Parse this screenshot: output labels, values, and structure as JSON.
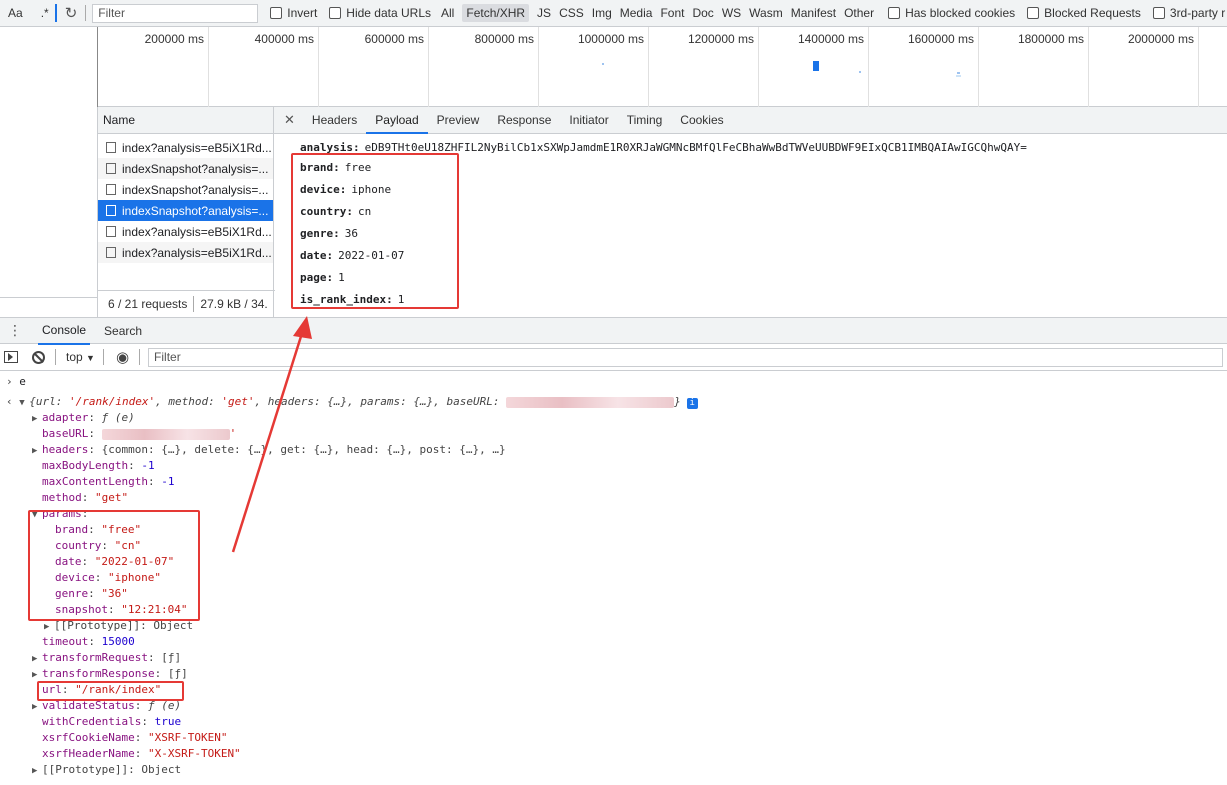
{
  "filterbar": {
    "aa_label": "Aa",
    "regex_label": ".*",
    "filter_placeholder": "Filter",
    "invert_label": "Invert",
    "hide_data_urls_label": "Hide data URLs",
    "types": [
      "All",
      "Fetch/XHR",
      "JS",
      "CSS",
      "Img",
      "Media",
      "Font",
      "Doc",
      "WS",
      "Wasm",
      "Manifest",
      "Other"
    ],
    "selected_type": "Fetch/XHR",
    "has_blocked_cookies_label": "Has blocked cookies",
    "blocked_requests_label": "Blocked Requests",
    "third_party_label": "3rd-party r"
  },
  "overview": {
    "ticks": [
      "200000 ms",
      "400000 ms",
      "600000 ms",
      "800000 ms",
      "1000000 ms",
      "1200000 ms",
      "1400000 ms",
      "1600000 ms",
      "1800000 ms",
      "2000000 ms"
    ]
  },
  "requests": {
    "header": "Name",
    "rows": [
      "index?analysis=eB5iX1Rd...",
      "indexSnapshot?analysis=...",
      "indexSnapshot?analysis=...",
      "indexSnapshot?analysis=...",
      "index?analysis=eB5iX1Rd...",
      "index?analysis=eB5iX1Rd..."
    ],
    "selected_index": 3,
    "footer_count": "6 / 21 requests",
    "footer_size": "27.9 kB / 34."
  },
  "detail": {
    "tabs": [
      "Headers",
      "Payload",
      "Preview",
      "Response",
      "Initiator",
      "Timing",
      "Cookies"
    ],
    "selected_tab": "Payload",
    "payload": [
      {
        "key": "analysis:",
        "value": "eDB9THt0eU18ZHFIL2NyBilCb1xSXWpJamdmE1R0XRJaWGMNcBMfQlFeCBhaWwBdTWVeUUBDWF9EIxQCB1IMBQAIAwIGCQhwQAY="
      },
      {
        "key": "brand:",
        "value": "free"
      },
      {
        "key": "device:",
        "value": "iphone"
      },
      {
        "key": "country:",
        "value": "cn"
      },
      {
        "key": "genre:",
        "value": "36"
      },
      {
        "key": "date:",
        "value": "2022-01-07"
      },
      {
        "key": "page:",
        "value": "1"
      },
      {
        "key": "is_rank_index:",
        "value": "1"
      }
    ]
  },
  "drawer": {
    "tabs": [
      "Console",
      "Search"
    ],
    "selected_tab": "Console",
    "context": "top",
    "filter_placeholder": "Filter"
  },
  "console": {
    "input_line": "e",
    "summary": {
      "open": "{url: ",
      "url_val": "'/rank/index'",
      "method_key": ", method: ",
      "method_val": "'get'",
      "rest": ", headers: {…}, params: {…}, baseURL: ",
      "close": "}"
    },
    "props": [
      {
        "key": "adapter",
        "value": "ƒ (e)",
        "kind": "fn",
        "expandable": true
      },
      {
        "key": "baseURL",
        "value": "",
        "kind": "blurred",
        "expandable": false
      },
      {
        "key": "headers",
        "value": "{common: {…}, delete: {…}, get: {…}, head: {…}, post: {…}, …}",
        "kind": "obj",
        "expandable": true
      },
      {
        "key": "maxBodyLength",
        "value": "-1",
        "kind": "num",
        "expandable": false
      },
      {
        "key": "maxContentLength",
        "value": "-1",
        "kind": "num",
        "expandable": false
      },
      {
        "key": "method",
        "value": "\"get\"",
        "kind": "str",
        "expandable": false
      },
      {
        "key": "params",
        "value": "",
        "kind": "open",
        "expandable": true
      }
    ],
    "params": [
      {
        "key": "brand",
        "value": "\"free\""
      },
      {
        "key": "country",
        "value": "\"cn\""
      },
      {
        "key": "date",
        "value": "\"2022-01-07\""
      },
      {
        "key": "device",
        "value": "\"iphone\""
      },
      {
        "key": "genre",
        "value": "\"36\""
      },
      {
        "key": "snapshot",
        "value": "\"12:21:04\""
      }
    ],
    "params_proto": "[[Prototype]]: Object",
    "props_after": [
      {
        "key": "timeout",
        "value": "15000",
        "kind": "num",
        "expandable": false
      },
      {
        "key": "transformRequest",
        "value": "[ƒ]",
        "kind": "obj",
        "expandable": true
      },
      {
        "key": "transformResponse",
        "value": "[ƒ]",
        "kind": "obj",
        "expandable": true
      },
      {
        "key": "url",
        "value": "\"/rank/index\"",
        "kind": "str",
        "expandable": false
      },
      {
        "key": "validateStatus",
        "value": "ƒ (e)",
        "kind": "fn",
        "expandable": true
      },
      {
        "key": "withCredentials",
        "value": "true",
        "kind": "num",
        "expandable": false
      },
      {
        "key": "xsrfCookieName",
        "value": "\"XSRF-TOKEN\"",
        "kind": "str",
        "expandable": false
      },
      {
        "key": "xsrfHeaderName",
        "value": "\"X-XSRF-TOKEN\"",
        "kind": "str",
        "expandable": false
      }
    ],
    "proto": "[[Prototype]]: Object"
  },
  "colors": {
    "accent": "#1a73e8",
    "annotation": "#e53935",
    "key": "#881280",
    "string": "#c41a16",
    "number": "#1c00cf"
  }
}
